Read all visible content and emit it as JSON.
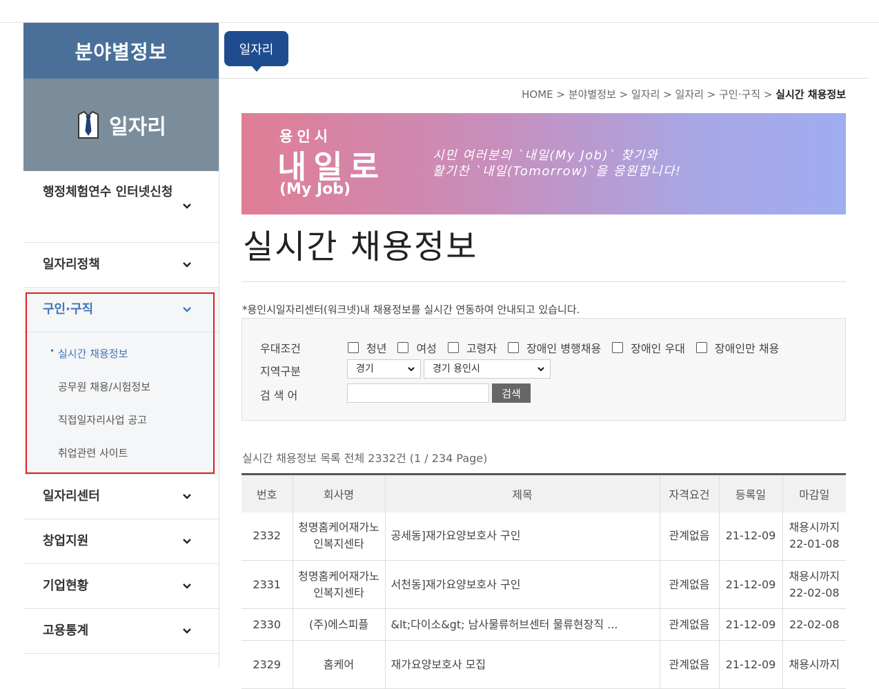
{
  "sidebar": {
    "header": "분야별정보",
    "category": "일자리",
    "menu": [
      {
        "label": "행정체험연수 인터넷신청"
      },
      {
        "label": "일자리정책"
      },
      {
        "label": "구인·구직"
      },
      {
        "label": "일자리센터"
      },
      {
        "label": "창업지원"
      },
      {
        "label": "기업현황"
      },
      {
        "label": "고용통계"
      }
    ],
    "submenu": [
      {
        "label": "실시간 채용정보"
      },
      {
        "label": "공무원 채용/시험정보"
      },
      {
        "label": "직접일자리사업 공고"
      },
      {
        "label": "취업관련 사이트"
      }
    ]
  },
  "tab": {
    "label": "일자리"
  },
  "breadcrumb": {
    "home": "HOME",
    "sep": ">",
    "items": [
      "분야별정보",
      "일자리",
      "일자리",
      "구인·구직"
    ],
    "current": "실시간 채용정보"
  },
  "banner": {
    "small": "용인시",
    "big": "내일로",
    "sub": "(My Job)",
    "slogan1": "시민 여러분의 `내일(My Job)` 찾기와",
    "slogan2": "활기찬 `내일(Tomorrow)`을 응원합니다!"
  },
  "page_title": "실시간 채용정보",
  "notice": "*용인시일자리센터(워크넷)내 채용정보를 실시간 연동하여 안내되고 있습니다.",
  "search": {
    "condition_label": "우대조건",
    "conditions": [
      "청년",
      "여성",
      "고령자",
      "장애인 병행채용",
      "장애인 우대",
      "장애인만 채용"
    ],
    "region_label": "지역구분",
    "region1": "경기",
    "region2": "경기 용인시",
    "keyword_label": "검 색 어",
    "keyword_value": "",
    "button": "검색"
  },
  "count_text": "실시간 채용정보 목록 전체 2332건 (1 / 234 Page)",
  "table": {
    "headers": [
      "번호",
      "회사명",
      "제목",
      "자격요건",
      "등록일",
      "마감일"
    ],
    "rows": [
      {
        "no": "2332",
        "company1": "청명홈케어재가노",
        "company2": "인복지센타",
        "title": "공세동]재가요양보호사 구인",
        "req": "관계없음",
        "reg": "21-12-09",
        "dead1": "채용시까지",
        "dead2": "22-01-08"
      },
      {
        "no": "2331",
        "company1": "청명홈케어재가노",
        "company2": "인복지센타",
        "title": "서천동]재가요양보호사 구인",
        "req": "관계없음",
        "reg": "21-12-09",
        "dead1": "채용시까지",
        "dead2": "22-02-08"
      },
      {
        "no": "2330",
        "company1": "(주)에스피플",
        "company2": "",
        "title": "&lt;다이소&gt; 남사물류허브센터 물류현장직 ...",
        "req": "관계없음",
        "reg": "21-12-09",
        "dead1": "22-02-08",
        "dead2": ""
      },
      {
        "no": "2329",
        "company1": "홈케어",
        "company2": "",
        "title": "재가요양보호사 모집",
        "req": "관계없음",
        "reg": "21-12-09",
        "dead1": "채용시까지",
        "dead2": ""
      }
    ]
  }
}
